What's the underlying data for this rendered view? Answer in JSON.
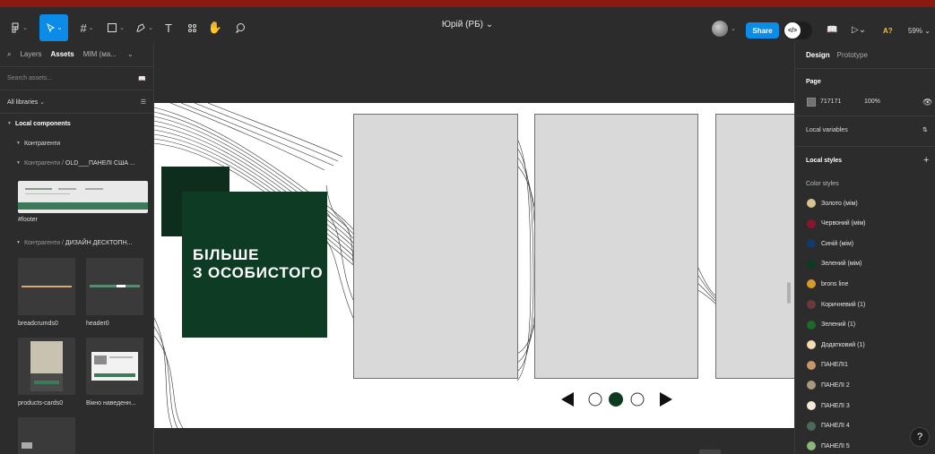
{
  "toolbar": {
    "main_menu_icon": "figma-menu-icon",
    "move_tool_icon": "cursor-icon",
    "frame_tool_icon": "frame-icon",
    "shape_tool_icon": "rectangle-icon",
    "pen_tool_icon": "pen-icon",
    "text_tool": "T",
    "resources_icon": "resources-icon",
    "hand_tool_icon": "hand-icon",
    "comment_tool_icon": "comment-icon",
    "file_title": "Юрій (РБ)",
    "share_label": "Share",
    "dev_mode_glyph": "</>",
    "library_icon": "book-icon",
    "present_icon": "play-icon",
    "font_warning": "A?",
    "zoom": "59%"
  },
  "left_panel": {
    "tab_layers": "Layers",
    "tab_assets": "Assets",
    "page_selector": "MIM (ма...",
    "search_placeholder": "Search assets...",
    "libraries_label": "All libraries",
    "local_components": "Local components",
    "group1": "Контрагенти",
    "group2_prefix": "Контрагенти /",
    "group2_name": "OLD___ПАНЕЛІ США ...",
    "footer_label": "#footer",
    "group3_prefix": "Контрагенти /",
    "group3_name": "ДИЗАЙН ДЕСКТОПН...",
    "components": [
      {
        "label": "breadcrumds0"
      },
      {
        "label": "header0"
      },
      {
        "label": "products-cards0"
      },
      {
        "label": "Вікно наведенн..."
      }
    ]
  },
  "right_panel": {
    "tab_design": "Design",
    "tab_prototype": "Prototype",
    "page_label": "Page",
    "page_color": "717171",
    "page_opacity": "100%",
    "local_variables": "Local variables",
    "local_styles": "Local styles",
    "color_styles_label": "Color styles",
    "color_styles": [
      {
        "name": "Золото (мім)",
        "color": "#d8c48c"
      },
      {
        "name": "Червоний (мім)",
        "color": "#8a1430"
      },
      {
        "name": "Синій (мім)",
        "color": "#143a6a"
      },
      {
        "name": "Зелений (мім)",
        "color": "#0f3a22"
      },
      {
        "name": "brons line",
        "color": "#d99a2a"
      },
      {
        "name": "Коричневий (1)",
        "color": "#6a3a3a"
      },
      {
        "name": "Зелений (1)",
        "color": "#1a6a2a"
      },
      {
        "name": "Додатковий (1)",
        "color": "#f2dcb0"
      },
      {
        "name": "ПАНЕЛІ1",
        "color": "#c9956a"
      },
      {
        "name": "ПАНЕЛІ 2",
        "color": "#a89a80"
      },
      {
        "name": "ПАНЕЛІ 3",
        "color": "#f4ead8"
      },
      {
        "name": "ПАНЕЛІ 4",
        "color": "#4a6a5a"
      },
      {
        "name": "ПАНЕЛІ 5",
        "color": "#8ab87a"
      }
    ]
  },
  "canvas": {
    "promo_line1": "БІЛЬШЕ",
    "promo_line2": "З ОСОБИСТОГО",
    "accent_dark": "#0e3b24",
    "pagination_icons": [
      "arrow-left-icon",
      "dot-empty",
      "dot-filled",
      "dot-empty",
      "arrow-right-icon"
    ]
  },
  "help_label": "?"
}
